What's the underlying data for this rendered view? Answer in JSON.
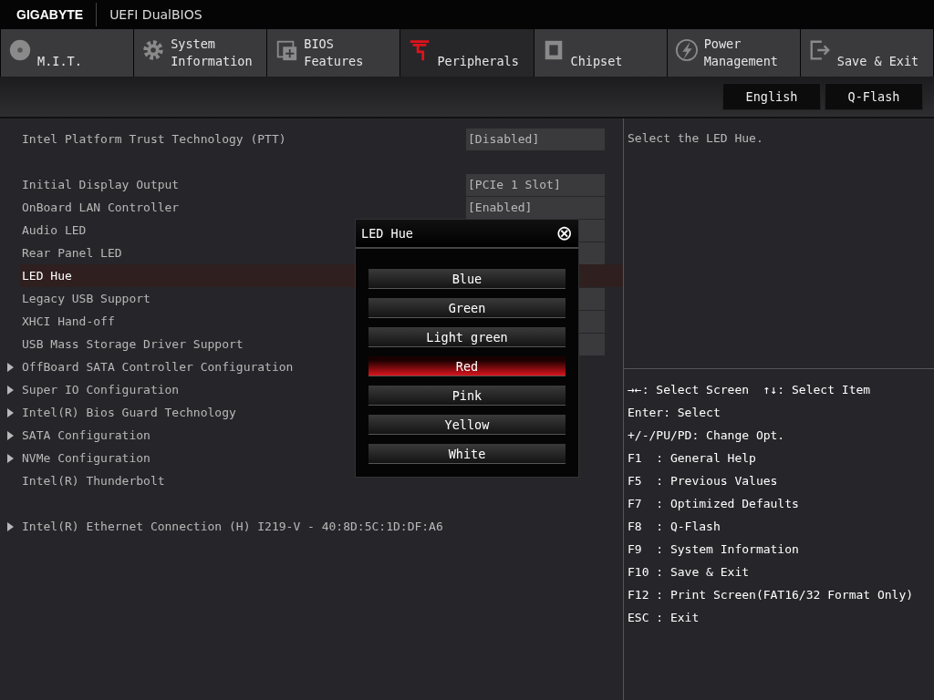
{
  "header": {
    "brand": "GIGABYTE",
    "title": "UEFI DualBIOS"
  },
  "tabs": [
    {
      "lines": [
        "M.I.T."
      ],
      "selected": false
    },
    {
      "lines": [
        "System",
        "Information"
      ],
      "selected": false
    },
    {
      "lines": [
        "BIOS",
        "Features"
      ],
      "selected": false
    },
    {
      "lines": [
        "Peripherals"
      ],
      "selected": true
    },
    {
      "lines": [
        "Chipset"
      ],
      "selected": false
    },
    {
      "lines": [
        "Power",
        "Management"
      ],
      "selected": false
    },
    {
      "lines": [
        "Save & Exit"
      ],
      "selected": false
    }
  ],
  "top_buttons": [
    "English",
    "Q-Flash"
  ],
  "groups": [
    [
      {
        "kind": "setting",
        "label": "Intel Platform Trust Technology (PTT)",
        "value": "[Disabled]",
        "selected": false
      }
    ],
    [
      {
        "kind": "setting",
        "label": "Initial Display Output",
        "value": "[PCIe 1 Slot]",
        "selected": false
      },
      {
        "kind": "setting",
        "label": "OnBoard LAN Controller",
        "value": "[Enabled]",
        "selected": false
      },
      {
        "kind": "covered",
        "label": "Audio LED",
        "selected": false
      },
      {
        "kind": "covered",
        "label": "Rear Panel LED",
        "selected": false
      },
      {
        "kind": "covered",
        "label": "LED Hue",
        "selected": true
      },
      {
        "kind": "covered",
        "label": "Legacy USB Support",
        "selected": false
      },
      {
        "kind": "covered",
        "label": "XHCI Hand-off",
        "selected": false
      },
      {
        "kind": "covered",
        "label": "USB Mass Storage Driver Support",
        "selected": false
      },
      {
        "kind": "submenu",
        "label": "OffBoard SATA Controller Configuration",
        "selected": false
      },
      {
        "kind": "submenu",
        "label": "Super IO Configuration",
        "selected": false
      },
      {
        "kind": "submenu",
        "label": "Intel(R) Bios Guard Technology",
        "selected": false
      },
      {
        "kind": "submenu",
        "label": "SATA Configuration",
        "selected": false
      },
      {
        "kind": "submenu",
        "label": "NVMe Configuration",
        "selected": false
      },
      {
        "kind": "plain",
        "label": "Intel(R) Thunderbolt",
        "selected": false
      }
    ],
    [
      {
        "kind": "submenu",
        "label": "Intel(R) Ethernet Connection (H) I219-V - 40:8D:5C:1D:DF:A6",
        "selected": false
      }
    ]
  ],
  "help_text": "Select the LED Hue.",
  "key_help": [
    "→←: Select Screen  ↑↓: Select Item",
    "Enter: Select",
    "+/-/PU/PD: Change Opt.",
    "F1  : General Help",
    "F5  : Previous Values",
    "F7  : Optimized Defaults",
    "F8  : Q-Flash",
    "F9  : System Information",
    "F10 : Save & Exit",
    "F12 : Print Screen(FAT16/32 Format Only)",
    "ESC : Exit"
  ],
  "popup": {
    "title": "LED Hue",
    "close": "⊗",
    "options": [
      {
        "label": "Blue",
        "selected": false
      },
      {
        "label": "Green",
        "selected": false
      },
      {
        "label": "Light green",
        "selected": false
      },
      {
        "label": "Red",
        "selected": true
      },
      {
        "label": "Pink",
        "selected": false
      },
      {
        "label": "Yellow",
        "selected": false
      },
      {
        "label": "White",
        "selected": false
      }
    ]
  }
}
